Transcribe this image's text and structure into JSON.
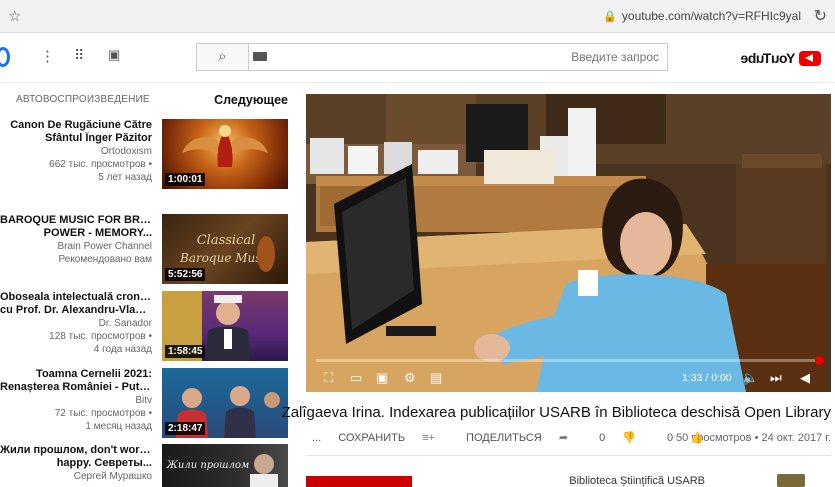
{
  "browser": {
    "url": "youtube.com/watch?v=RFHIc9yal"
  },
  "header": {
    "logo_text": "YouTube",
    "search_placeholder": "Введите запрос"
  },
  "sidebar": {
    "up_next": "Следующее",
    "autoplay": "АВТОВОСПРОИЗВЕДЕНИЕ",
    "videos": [
      {
        "title": "Canon De Rugăciune Către",
        "title2": "Sfântul Înger Păzitor",
        "channel": "Ortodoxism",
        "views": "662 тыс. просмотров •",
        "age": "5 лет назад",
        "duration": "1:00:01"
      },
      {
        "title": "BAROQUE MUSIC FOR BRAIN",
        "title2": "POWER - MEMORY...",
        "channel": "Brain Power Channel",
        "views": "Рекомендовано вам",
        "age": "",
        "duration": "5:52:56"
      },
      {
        "title": "Obosealа intelectuală cronica",
        "title2": "cu Prof. Dr. Alexandru-Vladim...",
        "channel": "Dr. Sanador",
        "views": "128 тыс. просмотров •",
        "age": "4 года назад",
        "duration": "1:58:45"
      },
      {
        "title": "Toamna Cernelii 2021:",
        "title2": "Renașterea României - Puteri...",
        "channel": "Bitv",
        "views": "72 тыс. просмотров •",
        "age": "1 месяц назад",
        "duration": "2:18:47"
      },
      {
        "title": "Жили прошлом, don't worry, be",
        "title2": "happy. Севpeты...",
        "channel": "Сергей Мурашко",
        "views": "",
        "age": "",
        "duration": ""
      }
    ]
  },
  "player": {
    "time_current": "0:00",
    "time_total": "1:33"
  },
  "video": {
    "title": "Zalîgaeva Irina. Indexarea publicațiilor USARB în Biblioteca deschisă Open Library",
    "views_date": "50 просмотров • 24 окт. 2017 г.",
    "likes": "0",
    "dislikes": "0",
    "share": "ПОДЕЛИТЬСЯ",
    "save": "СОХРАНИТЬ",
    "more": "...",
    "channel_name": "Biblioteca Științifică USARB"
  }
}
